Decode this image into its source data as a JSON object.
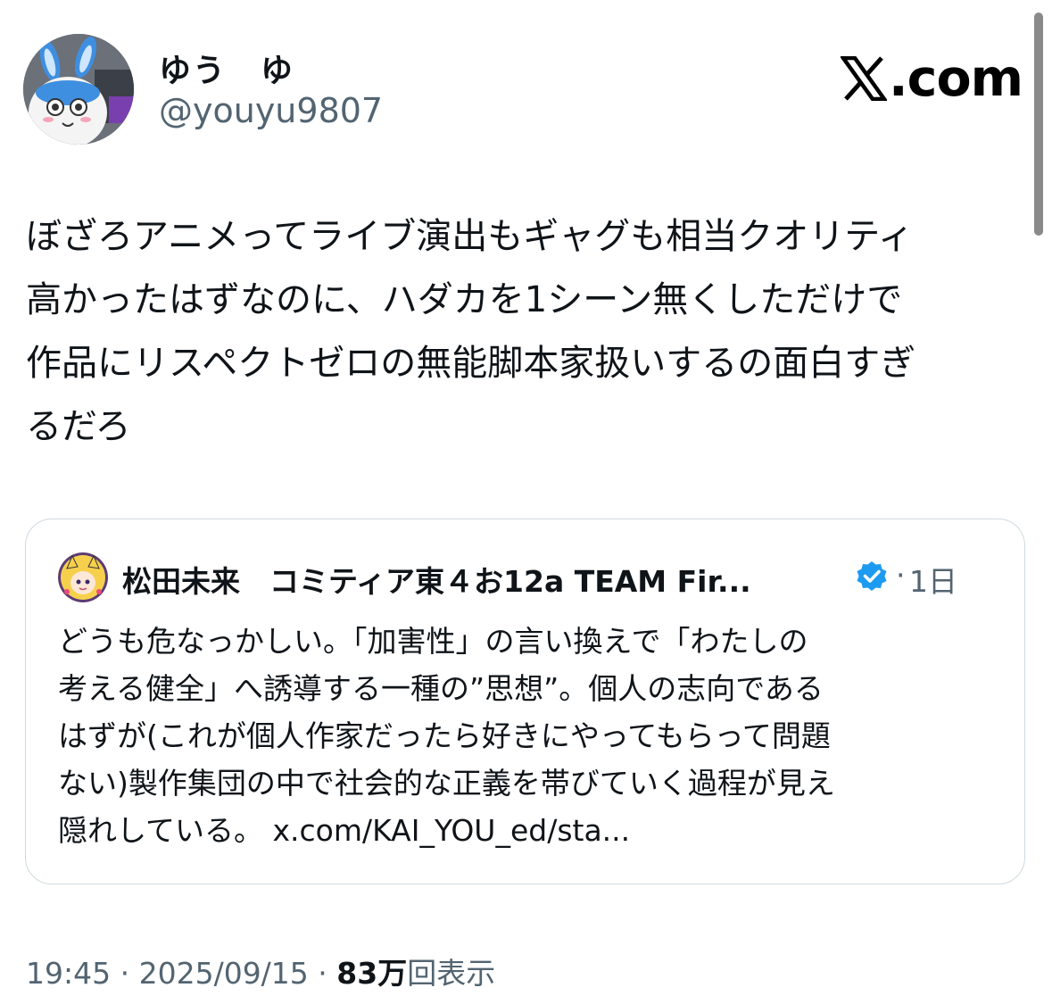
{
  "author": {
    "display_name": "ゆう　ゆ",
    "handle": "@youyu9807",
    "avatar_icon": "plush-rabbit-avatar-icon"
  },
  "brand": {
    "logo_text": ".com",
    "logo_icon": "x-logo-icon"
  },
  "tweet": {
    "text": "ぼざろアニメってライブ演出もギャグも相当クオリティ\n高かったはずなのに、ハダカを1シーン無くしただけで\n作品にリスペクトゼロの無能脚本家扱いするの面白すぎ\nるだろ"
  },
  "quote": {
    "author_name": "松田未来　コミティア東４お12a TEAM Fir...",
    "verified_icon": "verified-badge-icon",
    "separator": "·",
    "time": "1日",
    "text": "どうも危なっかしい。「加害性」の言い換えで「わたしの\n考える健全」へ誘導する一種の”思想”。個人の志向である\nはずが(これが個人作家だったら好きにやってもらって問題\nない)製作集団の中で社会的な正義を帯びていく過程が見え\n隠れしている。 x.com/KAI_YOU_ed/sta..."
  },
  "meta": {
    "time": "19:45",
    "separator": " · ",
    "date": "2025/09/15",
    "views_count": "83万",
    "views_label": "回表示"
  },
  "colors": {
    "text": "#0f1419",
    "secondary": "#536471",
    "border": "#cfd9de",
    "verified": "#1d9bf0"
  }
}
